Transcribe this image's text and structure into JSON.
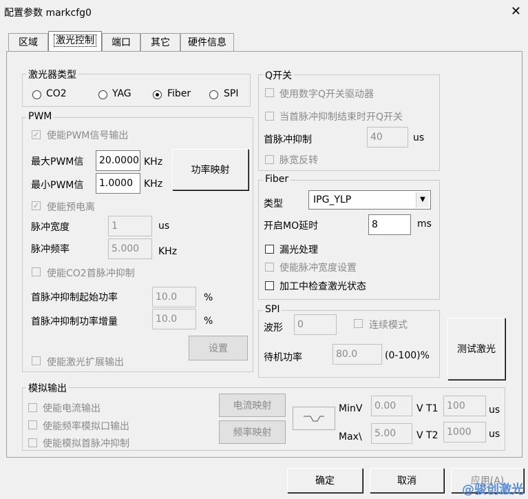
{
  "window": {
    "title": "配置参数 markcfg0",
    "close_icon": "✕"
  },
  "tabs": [
    "区域",
    "激光控制",
    "端口",
    "其它",
    "硬件信息"
  ],
  "laser_type": {
    "label": "激光器类型",
    "options": [
      "CO2",
      "YAG",
      "Fiber",
      "SPI"
    ],
    "selected": "Fiber"
  },
  "pwm": {
    "label": "PWM",
    "enable_pwm": "使能PWM信号输出",
    "max_label": "最大PWM信",
    "max_value": "20.0000",
    "max_unit": "KHz",
    "min_label": "最小PWM信",
    "min_value": "1.0000",
    "min_unit": "KHz",
    "power_map_btn": "功率映射",
    "enable_preion": "使能预电离",
    "pulse_width_label": "脉冲宽度",
    "pulse_width_value": "1",
    "pulse_width_unit": "us",
    "pulse_freq_label": "脉冲频率",
    "pulse_freq_value": "5.000",
    "pulse_freq_unit": "KHz",
    "enable_co2_fps": "使能CO2首脉冲抑制",
    "fps_start_label": "首脉冲抑制起始功率",
    "fps_start_value": "10.0",
    "fps_start_unit": "%",
    "fps_inc_label": "首脉冲抑制功率增量",
    "fps_inc_value": "10.0",
    "fps_inc_unit": "%",
    "set_btn": "设置",
    "enable_ext": "使能激光扩展输出"
  },
  "qswitch": {
    "label": "Q开关",
    "digital": "使用数字Q开关驱动器",
    "open_after": "当首脉冲抑制结束时开Q开关",
    "fps_label": "首脉冲抑制",
    "fps_value": "40",
    "fps_unit": "us",
    "invert": "脉宽反转"
  },
  "fiber": {
    "label": "Fiber",
    "type_label": "类型",
    "type_value": "IPG_YLP",
    "mo_label": "开启MO延时",
    "mo_value": "8",
    "mo_unit": "ms",
    "leak": "漏光处理",
    "enable_pw": "使能脉冲宽度设置",
    "check_state": "加工中检查激光状态"
  },
  "spi": {
    "label": "SPI",
    "wave_label": "波形",
    "wave_value": "0",
    "cont_mode": "连续模式",
    "standby_label": "待机功率",
    "standby_value": "80.0",
    "standby_range": "(0-100)%"
  },
  "test_laser_btn": "测试激光",
  "analog": {
    "label": "模拟输出",
    "enable_current": "使能电流输出",
    "enable_freq_analog": "使能频率模拟口输出",
    "enable_analog_fps": "使能模拟首脉冲抑制",
    "current_map_btn": "电流映射",
    "freq_map_btn": "频率映射",
    "minv_label": "MinV",
    "minv_value": "0.00",
    "maxv_label": "Max\\",
    "maxv_value": "5.00",
    "vt1_label": "V T1",
    "vt1_value": "100",
    "vt1_unit": "us",
    "vt2_label": "V T2",
    "vt2_value": "1000",
    "vt2_unit": "us"
  },
  "footer": {
    "ok": "确定",
    "cancel": "取消",
    "apply": "应用(A)"
  },
  "watermark": "@骏创激光"
}
